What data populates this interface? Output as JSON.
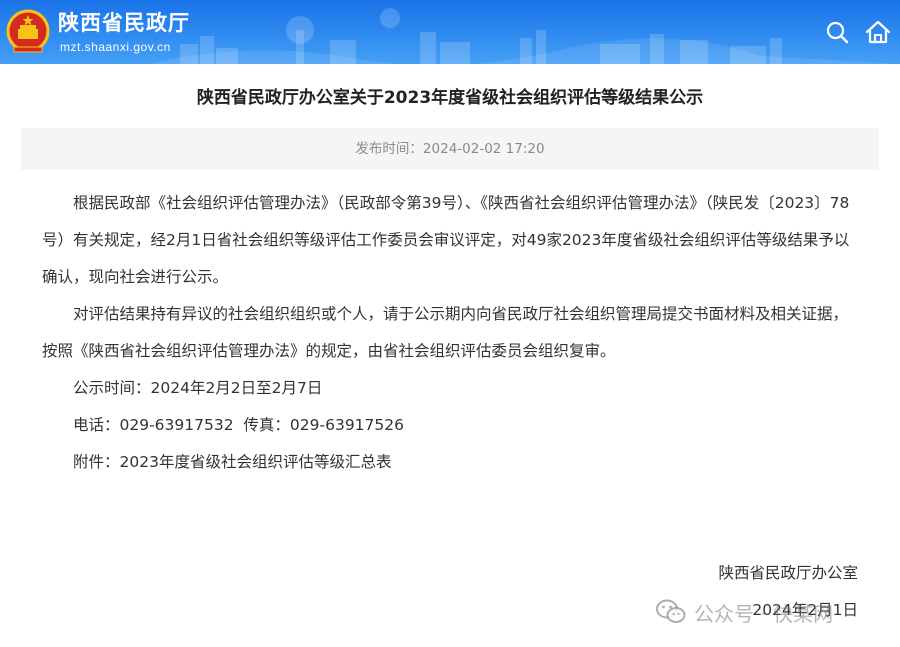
{
  "header": {
    "site_name": "陕西省民政厅",
    "site_domain": "mzt.shaanxi.gov.cn",
    "icons": {
      "emblem": "national-emblem",
      "search": "search-icon",
      "home": "home-icon"
    },
    "colors": {
      "header_bg": "#2f8bf0",
      "header_text": "#ffffff"
    }
  },
  "article": {
    "title": "陕西省民政厅办公室关于2023年度省级社会组织评估等级结果公示",
    "publish_label": "发布时间：",
    "publish_time": "2024-02-02 17:20",
    "paragraphs": [
      "根据民政部《社会组织评估管理办法》（民政部令第39号）、《陕西省社会组织评估管理办法》（陕民发〔2023〕78号）有关规定，经2月1日省社会组织等级评估工作委员会审议评定，对49家2023年度省级社会组织评估等级结果予以确认，现向社会进行公示。",
      "对评估结果持有异议的社会组织组织或个人，请于公示期内向省民政厅社会组织管理局提交书面材料及相关证据，按照《陕西省社会组织评估管理办法》的规定，由省社会组织评估委员会组织复审。",
      "公示时间：2024年2月2日至2月7日",
      "电话：029-63917532  传真：029-63917526",
      "附件：2023年度省级社会组织评估等级汇总表"
    ],
    "signature_org": "陕西省民政厅办公室",
    "signature_date": "2024年2月1日"
  },
  "watermark": {
    "icon": "wechat-icon",
    "text": "公众号 · 快某网"
  }
}
